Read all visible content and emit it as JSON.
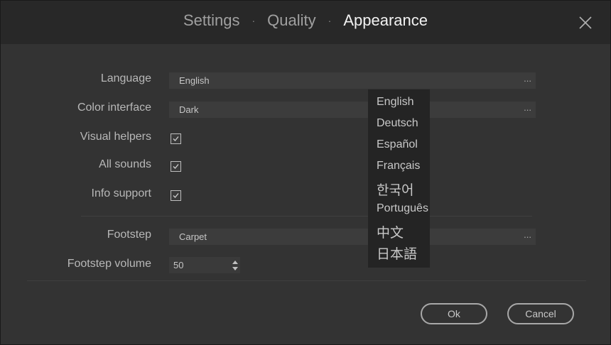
{
  "header": {
    "tabs": [
      {
        "label": "Settings"
      },
      {
        "label": "Quality"
      },
      {
        "label": "Appearance"
      }
    ],
    "separator": "·",
    "active_tab": "Appearance"
  },
  "settings": {
    "language": {
      "label": "Language",
      "value": "English",
      "more": "..."
    },
    "color_interface": {
      "label": "Color interface",
      "value": "Dark",
      "more": "..."
    },
    "visual_helpers": {
      "label": "Visual helpers",
      "checked": true
    },
    "all_sounds": {
      "label": "All sounds",
      "checked": true
    },
    "info_support": {
      "label": "Info support",
      "checked": true
    },
    "footstep": {
      "label": "Footstep",
      "value": "Carpet",
      "more": "..."
    },
    "footstep_volume": {
      "label": "Footstep volume",
      "value": "50"
    }
  },
  "language_dropdown": {
    "options": [
      "English",
      "Deutsch",
      "Español",
      "Français",
      "한국어",
      "Português",
      "中文",
      "日本語"
    ]
  },
  "buttons": {
    "ok": "Ok",
    "cancel": "Cancel"
  },
  "icons": {
    "close": "close-icon",
    "check": "checkmark-icon",
    "stepper": "up-down-arrows-icon"
  }
}
